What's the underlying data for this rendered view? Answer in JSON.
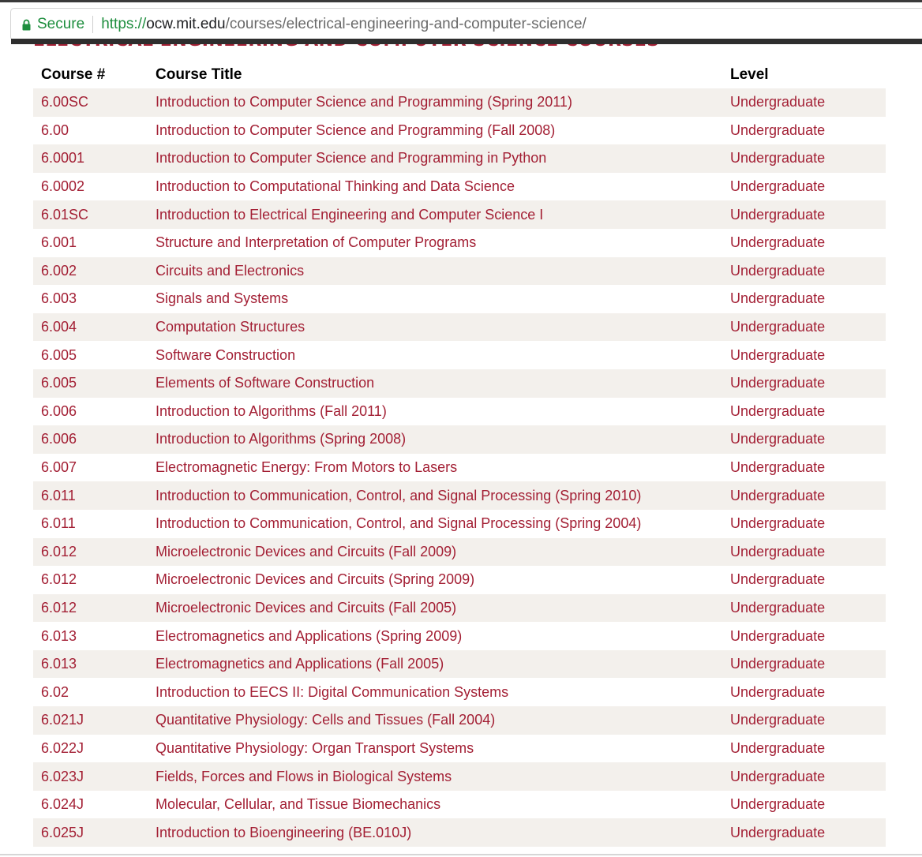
{
  "browser": {
    "secure_label": "Secure",
    "url_scheme": "https://",
    "url_host": "ocw.mit.edu",
    "url_path": "/courses/electrical-engineering-and-computer-science/"
  },
  "page": {
    "heading": "ELECTRICAL ENGINEERING AND COMPUTER SCIENCE COURSES",
    "accent_color": "#a31f34",
    "row_alt_color": "#f3f0ec"
  },
  "table": {
    "headers": {
      "number": "Course #",
      "title": "Course Title",
      "level": "Level"
    },
    "rows": [
      {
        "number": "6.00SC",
        "title": "Introduction to Computer Science and Programming (Spring 2011)",
        "level": "Undergraduate"
      },
      {
        "number": "6.00",
        "title": "Introduction to Computer Science and Programming (Fall 2008)",
        "level": "Undergraduate"
      },
      {
        "number": "6.0001",
        "title": "Introduction to Computer Science and Programming in Python",
        "level": "Undergraduate"
      },
      {
        "number": "6.0002",
        "title": "Introduction to Computational Thinking and Data Science",
        "level": "Undergraduate"
      },
      {
        "number": "6.01SC",
        "title": "Introduction to Electrical Engineering and Computer Science I",
        "level": "Undergraduate"
      },
      {
        "number": "6.001",
        "title": "Structure and Interpretation of Computer Programs",
        "level": "Undergraduate"
      },
      {
        "number": "6.002",
        "title": "Circuits and Electronics",
        "level": "Undergraduate"
      },
      {
        "number": "6.003",
        "title": "Signals and Systems",
        "level": "Undergraduate"
      },
      {
        "number": "6.004",
        "title": "Computation Structures",
        "level": "Undergraduate"
      },
      {
        "number": "6.005",
        "title": "Software Construction",
        "level": "Undergraduate"
      },
      {
        "number": "6.005",
        "title": "Elements of Software Construction",
        "level": "Undergraduate"
      },
      {
        "number": "6.006",
        "title": "Introduction to Algorithms (Fall 2011)",
        "level": "Undergraduate"
      },
      {
        "number": "6.006",
        "title": "Introduction to Algorithms (Spring 2008)",
        "level": "Undergraduate"
      },
      {
        "number": "6.007",
        "title": "Electromagnetic Energy: From Motors to Lasers",
        "level": "Undergraduate"
      },
      {
        "number": "6.011",
        "title": "Introduction to Communication, Control, and Signal Processing (Spring 2010)",
        "level": "Undergraduate"
      },
      {
        "number": "6.011",
        "title": "Introduction to Communication, Control, and Signal Processing (Spring 2004)",
        "level": "Undergraduate"
      },
      {
        "number": "6.012",
        "title": "Microelectronic Devices and Circuits (Fall 2009)",
        "level": "Undergraduate"
      },
      {
        "number": "6.012",
        "title": "Microelectronic Devices and Circuits (Spring 2009)",
        "level": "Undergraduate"
      },
      {
        "number": "6.012",
        "title": "Microelectronic Devices and Circuits (Fall 2005)",
        "level": "Undergraduate"
      },
      {
        "number": "6.013",
        "title": "Electromagnetics and Applications (Spring 2009)",
        "level": "Undergraduate"
      },
      {
        "number": "6.013",
        "title": "Electromagnetics and Applications (Fall 2005)",
        "level": "Undergraduate"
      },
      {
        "number": "6.02",
        "title": "Introduction to EECS II: Digital Communication Systems",
        "level": "Undergraduate"
      },
      {
        "number": "6.021J",
        "title": "Quantitative Physiology: Cells and Tissues (Fall 2004)",
        "level": "Undergraduate"
      },
      {
        "number": "6.022J",
        "title": "Quantitative Physiology: Organ Transport Systems",
        "level": "Undergraduate"
      },
      {
        "number": "6.023J",
        "title": "Fields, Forces and Flows in Biological Systems",
        "level": "Undergraduate"
      },
      {
        "number": "6.024J",
        "title": "Molecular, Cellular, and Tissue Biomechanics",
        "level": "Undergraduate"
      },
      {
        "number": "6.025J",
        "title": "Introduction to Bioengineering (BE.010J)",
        "level": "Undergraduate"
      }
    ]
  }
}
